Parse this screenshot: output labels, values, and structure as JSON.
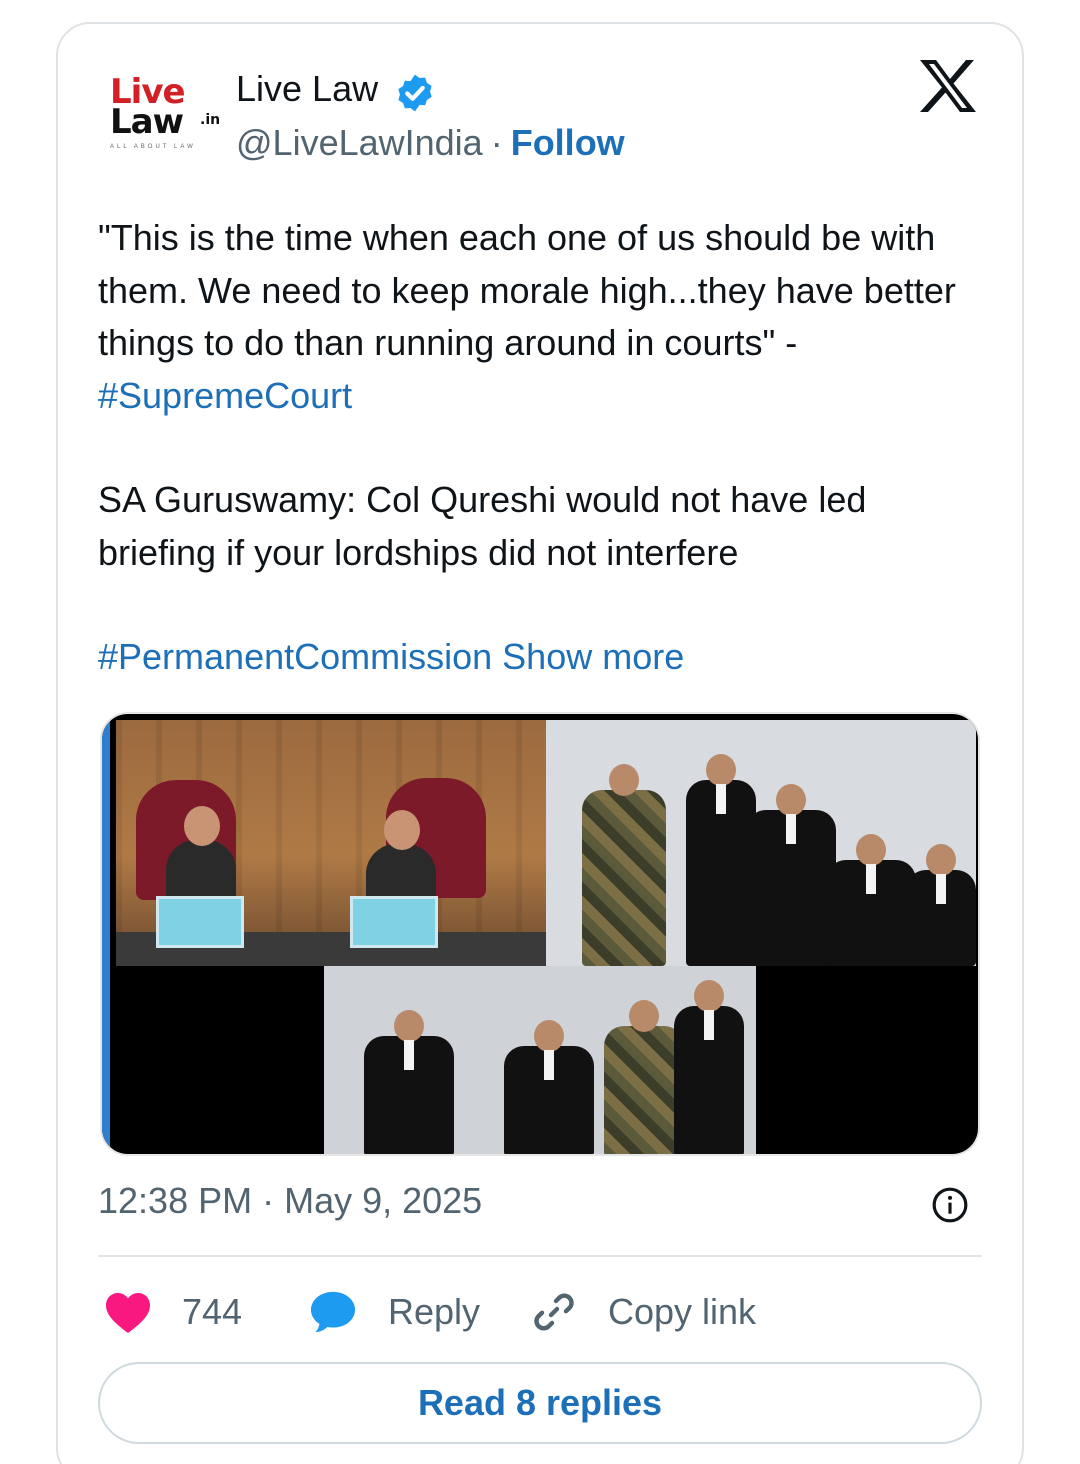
{
  "tweet": {
    "author": {
      "name": "Live Law",
      "handle": "@LiveLawIndia",
      "separator": "·",
      "follow_label": "Follow",
      "logo": {
        "line1": "Live",
        "line2": "Law",
        "suffix": ".in",
        "tagline": "ALL ABOUT LAW"
      }
    },
    "text": {
      "paragraph1": "\"This is the time when each one of us should be with them. We need to keep morale high...they have better things to do than running around in courts\" -",
      "hashtag1": "#SupremeCourt",
      "paragraph2": "SA Guruswamy: Col Qureshi would not have led briefing if your lordships did not interfere",
      "hashtag2": "#PermanentCommission",
      "show_more": "Show more"
    },
    "timestamp": "12:38 PM · May 9, 2025",
    "actions": {
      "likes": "744",
      "reply_label": "Reply",
      "copy_link_label": "Copy link"
    },
    "read_replies_label": "Read 8 replies"
  },
  "colors": {
    "link": "#1d6fb8",
    "like": "#f91880",
    "reply_icon": "#1d9bf0",
    "muted": "#536471",
    "verified": "#1d9bf0"
  },
  "icons": [
    "verified-badge-icon",
    "x-logo-icon",
    "heart-icon",
    "speech-bubble-icon",
    "link-icon",
    "info-icon"
  ]
}
